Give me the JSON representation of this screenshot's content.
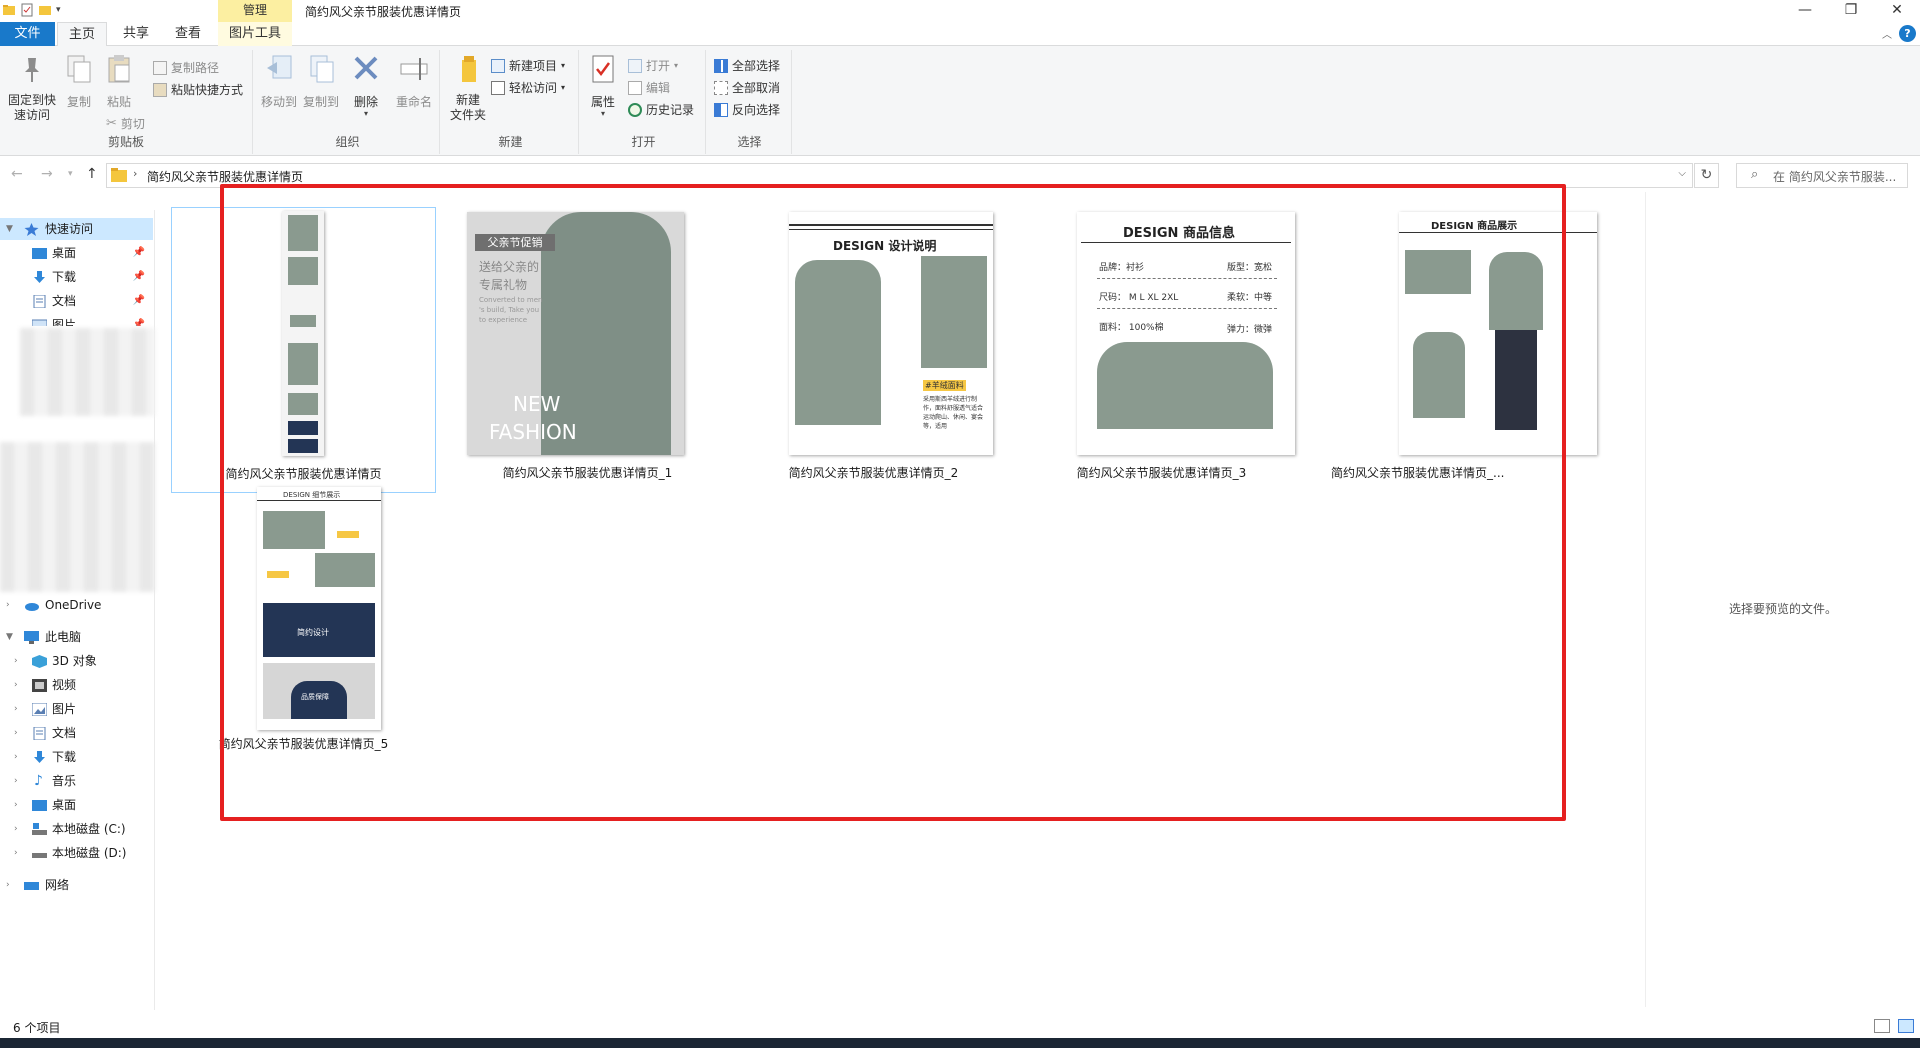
{
  "window": {
    "title": "简约风父亲节服装优惠详情页",
    "contextual_tab_group": "管理",
    "controls": {
      "minimize": "—",
      "maximize": "❐",
      "close": "✕"
    }
  },
  "ribbon_tabs": [
    "文件",
    "主页",
    "共享",
    "查看",
    "图片工具"
  ],
  "ribbon": {
    "clipboard": {
      "label": "剪贴板",
      "pin": "固定到快\n速访问",
      "copy": "复制",
      "paste": "粘贴",
      "copy_path": "复制路径",
      "paste_shortcut": "粘贴快捷方式",
      "cut": "剪切"
    },
    "organize": {
      "label": "组织",
      "move_to": "移动到",
      "copy_to": "复制到",
      "delete": "删除",
      "rename": "重命名"
    },
    "new": {
      "label": "新建",
      "new_folder": "新建\n文件夹",
      "new_item": "新建项目",
      "easy_access": "轻松访问"
    },
    "open": {
      "label": "打开",
      "properties": "属性",
      "open": "打开",
      "edit": "编辑",
      "history": "历史记录"
    },
    "select": {
      "label": "选择",
      "select_all": "全部选择",
      "select_none": "全部取消",
      "invert": "反向选择"
    }
  },
  "address": {
    "path": "简约风父亲节服装优惠详情页",
    "search_placeholder": "在 简约风父亲节服装..."
  },
  "nav": {
    "quick_access": "快速访问",
    "quick_items": [
      "桌面",
      "下载",
      "文档",
      "图片"
    ],
    "onedrive": "OneDrive",
    "this_pc": "此电脑",
    "pc_items": [
      "3D 对象",
      "视频",
      "图片",
      "文档",
      "下载",
      "音乐",
      "桌面",
      "本地磁盘 (C:)",
      "本地磁盘 (D:)"
    ],
    "network": "网络"
  },
  "files": [
    {
      "name": "简约风父亲节服装优惠详情页"
    },
    {
      "name": "简约风父亲节服装优惠详情页_1"
    },
    {
      "name": "简约风父亲节服装优惠详情页_2"
    },
    {
      "name": "简约风父亲节服装优惠详情页_3"
    },
    {
      "name": "简约风父亲节服装优惠详情页_..."
    },
    {
      "name": "简约风父亲节服装优惠详情页_5"
    }
  ],
  "thumb_text": {
    "t1_badge": "父亲节促销",
    "t1_sub1": "送给父亲的",
    "t1_sub2": "专属礼物",
    "t1_small1": "Converted to men",
    "t1_small2": "'s build, Take you",
    "t1_small3": "to experience",
    "t1_big1": "NEW",
    "t1_big2": "FASHION",
    "t2_title": "DESIGN 设计说明",
    "t2_tag": "#羊绒面料",
    "t2_desc1": "采用斯西羊绒进行制",
    "t2_desc2": "作，面料舒服透气适合",
    "t2_desc3": "运动爬山、休闲、宴会",
    "t2_desc4": "等，适用",
    "t3_title": "DESIGN 商品信息",
    "t3_brand": "品牌：衬衫",
    "t3_fit": "版型：宽松",
    "t3_size": "尺码： M L XL 2XL",
    "t3_soft": "柔软：中等",
    "t3_fabric": "面料： 100%棉",
    "t3_elastic": "弹力：微弹",
    "t4_title": "DESIGN 商品展示",
    "t5_title": "DESIGN 细节展示",
    "t5_block1": "简约设计",
    "t5_block2": "品质保障"
  },
  "preview_text": "选择要预览的文件。",
  "status": {
    "count": "6 个项目"
  },
  "colors": {
    "accent": "#1979ca",
    "highlight_box": "#e52020",
    "manage_tab": "#fcefa1",
    "shirt": "#8a9a8f"
  }
}
